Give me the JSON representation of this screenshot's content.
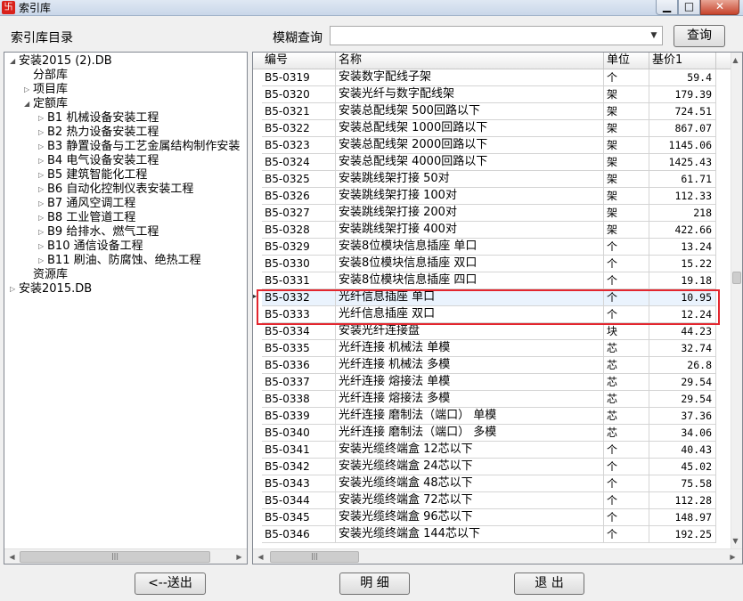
{
  "window": {
    "title": "索引库",
    "app_icon": "卐",
    "min_icon": "▁",
    "max_icon": "□",
    "close_icon": "✕"
  },
  "toolbar": {
    "dir_label": "索引库目录",
    "search_label": "模糊查询",
    "search_value": "",
    "dropdown_icon": "▼",
    "query_button": "查询"
  },
  "tree": {
    "expanded_icon": "◢",
    "collapsed_icon": "▷",
    "items": [
      {
        "label": "安装2015 (2).DB",
        "level": 0,
        "state": "expanded"
      },
      {
        "label": "分部库",
        "level": 1,
        "state": "leaf"
      },
      {
        "label": "项目库",
        "level": 1,
        "state": "collapsed"
      },
      {
        "label": "定额库",
        "level": 1,
        "state": "expanded"
      },
      {
        "label": "B1 机械设备安装工程",
        "level": 2,
        "state": "collapsed"
      },
      {
        "label": "B2 热力设备安装工程",
        "level": 2,
        "state": "collapsed"
      },
      {
        "label": "B3 静置设备与工艺金属结构制作安装",
        "level": 2,
        "state": "collapsed"
      },
      {
        "label": "B4 电气设备安装工程",
        "level": 2,
        "state": "collapsed"
      },
      {
        "label": "B5 建筑智能化工程",
        "level": 2,
        "state": "collapsed"
      },
      {
        "label": "B6 自动化控制仪表安装工程",
        "level": 2,
        "state": "collapsed"
      },
      {
        "label": "B7 通风空调工程",
        "level": 2,
        "state": "collapsed"
      },
      {
        "label": "B8 工业管道工程",
        "level": 2,
        "state": "collapsed"
      },
      {
        "label": "B9 给排水、燃气工程",
        "level": 2,
        "state": "collapsed"
      },
      {
        "label": "B10 通信设备工程",
        "level": 2,
        "state": "collapsed"
      },
      {
        "label": "B11 刷油、防腐蚀、绝热工程",
        "level": 2,
        "state": "collapsed"
      },
      {
        "label": "资源库",
        "level": 1,
        "state": "leaf"
      },
      {
        "label": "安装2015.DB",
        "level": 0,
        "state": "collapsed"
      }
    ]
  },
  "grid": {
    "columns": [
      "编号",
      "名称",
      "单位",
      "基价1"
    ],
    "selected_marker": "▶",
    "rows": [
      {
        "code": "B5-0319",
        "name": "安装数字配线子架",
        "unit": "个",
        "price": "59.4"
      },
      {
        "code": "B5-0320",
        "name": "安装光纤与数字配线架",
        "unit": "架",
        "price": "179.39"
      },
      {
        "code": "B5-0321",
        "name": "安装总配线架 500回路以下",
        "unit": "架",
        "price": "724.51"
      },
      {
        "code": "B5-0322",
        "name": "安装总配线架 1000回路以下",
        "unit": "架",
        "price": "867.07"
      },
      {
        "code": "B5-0323",
        "name": "安装总配线架 2000回路以下",
        "unit": "架",
        "price": "1145.06"
      },
      {
        "code": "B5-0324",
        "name": "安装总配线架 4000回路以下",
        "unit": "架",
        "price": "1425.43"
      },
      {
        "code": "B5-0325",
        "name": "安装跳线架打接 50对",
        "unit": "架",
        "price": "61.71"
      },
      {
        "code": "B5-0326",
        "name": "安装跳线架打接 100对",
        "unit": "架",
        "price": "112.33"
      },
      {
        "code": "B5-0327",
        "name": "安装跳线架打接 200对",
        "unit": "架",
        "price": "218"
      },
      {
        "code": "B5-0328",
        "name": "安装跳线架打接 400对",
        "unit": "架",
        "price": "422.66"
      },
      {
        "code": "B5-0329",
        "name": "安装8位模块信息插座 单口",
        "unit": "个",
        "price": "13.24"
      },
      {
        "code": "B5-0330",
        "name": "安装8位模块信息插座 双口",
        "unit": "个",
        "price": "15.22"
      },
      {
        "code": "B5-0331",
        "name": "安装8位模块信息插座 四口",
        "unit": "个",
        "price": "19.18"
      },
      {
        "code": "B5-0332",
        "name": "光纤信息插座 单口",
        "unit": "个",
        "price": "10.95"
      },
      {
        "code": "B5-0333",
        "name": "光纤信息插座 双口",
        "unit": "个",
        "price": "12.24"
      },
      {
        "code": "B5-0334",
        "name": "安装光纤连接盘",
        "unit": "块",
        "price": "44.23"
      },
      {
        "code": "B5-0335",
        "name": "光纤连接 机械法 单模",
        "unit": "芯",
        "price": "32.74"
      },
      {
        "code": "B5-0336",
        "name": "光纤连接 机械法 多模",
        "unit": "芯",
        "price": "26.8"
      },
      {
        "code": "B5-0337",
        "name": "光纤连接 熔接法 单模",
        "unit": "芯",
        "price": "29.54"
      },
      {
        "code": "B5-0338",
        "name": "光纤连接 熔接法 多模",
        "unit": "芯",
        "price": "29.54"
      },
      {
        "code": "B5-0339",
        "name": "光纤连接 磨制法（端口） 单模",
        "unit": "芯",
        "price": "37.36"
      },
      {
        "code": "B5-0340",
        "name": "光纤连接 磨制法（端口） 多模",
        "unit": "芯",
        "price": "34.06"
      },
      {
        "code": "B5-0341",
        "name": "安装光缆终端盒 12芯以下",
        "unit": "个",
        "price": "40.43"
      },
      {
        "code": "B5-0342",
        "name": "安装光缆终端盒 24芯以下",
        "unit": "个",
        "price": "45.02"
      },
      {
        "code": "B5-0343",
        "name": "安装光缆终端盒 48芯以下",
        "unit": "个",
        "price": "75.58"
      },
      {
        "code": "B5-0344",
        "name": "安装光缆终端盒 72芯以下",
        "unit": "个",
        "price": "112.28"
      },
      {
        "code": "B5-0345",
        "name": "安装光缆终端盒 96芯以下",
        "unit": "个",
        "price": "148.97"
      },
      {
        "code": "B5-0346",
        "name": "安装光缆终端盒 144芯以下",
        "unit": "个",
        "price": "192.25"
      }
    ]
  },
  "scrollbars": {
    "left_arrow": "◀",
    "right_arrow": "▶",
    "up_arrow": "▲",
    "down_arrow": "▼",
    "thumb_grip": "|||"
  },
  "buttons": {
    "send": "<--送出",
    "detail": "明 细",
    "exit": "退 出"
  }
}
